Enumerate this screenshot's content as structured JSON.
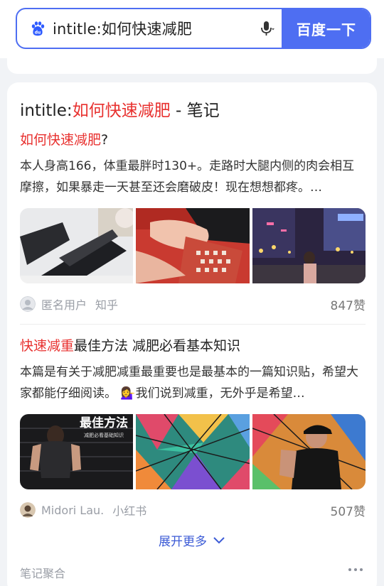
{
  "search": {
    "query": "intitle:如何快速减肥",
    "button_label": "百度一下",
    "logo_text": "du"
  },
  "card": {
    "title_prefix": "intitle:",
    "title_highlight": "如何快速减肥",
    "title_suffix": " - 笔记",
    "results": [
      {
        "title_highlight": "如何快速减肥",
        "title_rest": "?",
        "desc": "本人身高166，体重最胖时130+。走路时大腿内侧的肉会相互摩擦，如果暴走一天甚至还会磨破皮！现在想想都疼。…",
        "author": "匿名用户",
        "source": "知乎",
        "likes": "847赞"
      },
      {
        "title_highlight": "快速减重",
        "title_rest": "最佳方法 减肥必看基本知识",
        "desc": "本篇是有关于减肥减重最重要也是最基本的一篇知识贴，希望大家都能仔细阅读。 💁‍♀️我们说到减重，无外乎是希望…",
        "author": "Midori Lau.",
        "source": "小红书",
        "likes": "507赞",
        "thumb_overlay_title": "最佳方法",
        "thumb_overlay_sub": "减肥必看基础知识"
      }
    ],
    "expand_label": "展开更多",
    "footer_label": "笔记聚合"
  },
  "colors": {
    "accent": "#4e6ef2",
    "highlight": "#e8312f",
    "link": "#3c5bd6"
  }
}
